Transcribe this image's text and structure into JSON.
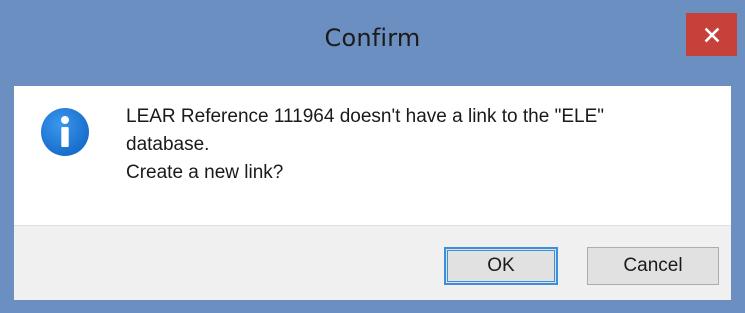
{
  "window": {
    "title": "Confirm"
  },
  "icons": {
    "close": "close-icon",
    "info": "info-icon"
  },
  "message": {
    "lines": [
      "LEAR Reference 111964 doesn't have a link to the \"ELE\"",
      "database.",
      "Create a new link?"
    ]
  },
  "buttons": {
    "ok_label": "OK",
    "cancel_label": "Cancel"
  },
  "colors": {
    "frame": "#6b8fc0",
    "close_button": "#c7413b",
    "info_icon": "#1e7ad6",
    "focus_border": "#3c8fdc",
    "footer": "#f0f0f0"
  }
}
